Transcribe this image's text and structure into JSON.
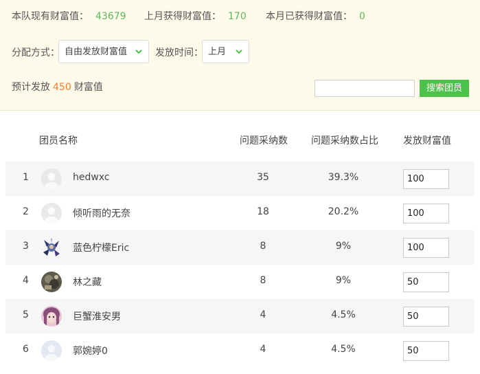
{
  "stats": {
    "team_wealth_label": "本队现有财富值：",
    "team_wealth_value": "43679",
    "last_month_label": "上月获得财富值：",
    "last_month_value": "170",
    "this_month_label": "本月已获得财富值：",
    "this_month_value": "0"
  },
  "controls": {
    "method_label": "分配方式：",
    "method_value": "自由发放财富值",
    "time_label": "发放时间：",
    "time_value": "上月"
  },
  "estimate": {
    "prefix": "预计发放",
    "amount": "450",
    "suffix": "财富值"
  },
  "search": {
    "value": "",
    "button_label": "搜索团员"
  },
  "table": {
    "headers": {
      "name": "团员名称",
      "adopted": "问题采纳数",
      "ratio": "问题采纳数占比",
      "wealth": "发放财富值"
    },
    "rows": [
      {
        "index": "1",
        "name": "hedwxc",
        "adopted": "35",
        "ratio": "39.3%",
        "wealth": "100",
        "avatar": "default-avatar-icon"
      },
      {
        "index": "2",
        "name": "倾听雨的无奈",
        "adopted": "18",
        "ratio": "20.2%",
        "wealth": "100",
        "avatar": "default-avatar-icon"
      },
      {
        "index": "3",
        "name": "蓝色柠檬Eric",
        "adopted": "8",
        "ratio": "9%",
        "wealth": "100",
        "avatar": "character-avatar-icon"
      },
      {
        "index": "4",
        "name": "林之藏",
        "adopted": "8",
        "ratio": "9%",
        "wealth": "50",
        "avatar": "photo-avatar-icon"
      },
      {
        "index": "5",
        "name": "巨蟹淮安男",
        "adopted": "4",
        "ratio": "4.5%",
        "wealth": "50",
        "avatar": "girl-avatar-icon"
      },
      {
        "index": "6",
        "name": "郭婉婷0",
        "adopted": "4",
        "ratio": "4.5%",
        "wealth": "50",
        "avatar": "default-avatar-icon"
      }
    ]
  },
  "colors": {
    "panel_bg": "#fefbea",
    "stat_green": "#5cb85c",
    "accent_orange": "#ee7d2e",
    "button_green": "#4cc24c",
    "row_shade": "#f6f6f6"
  }
}
